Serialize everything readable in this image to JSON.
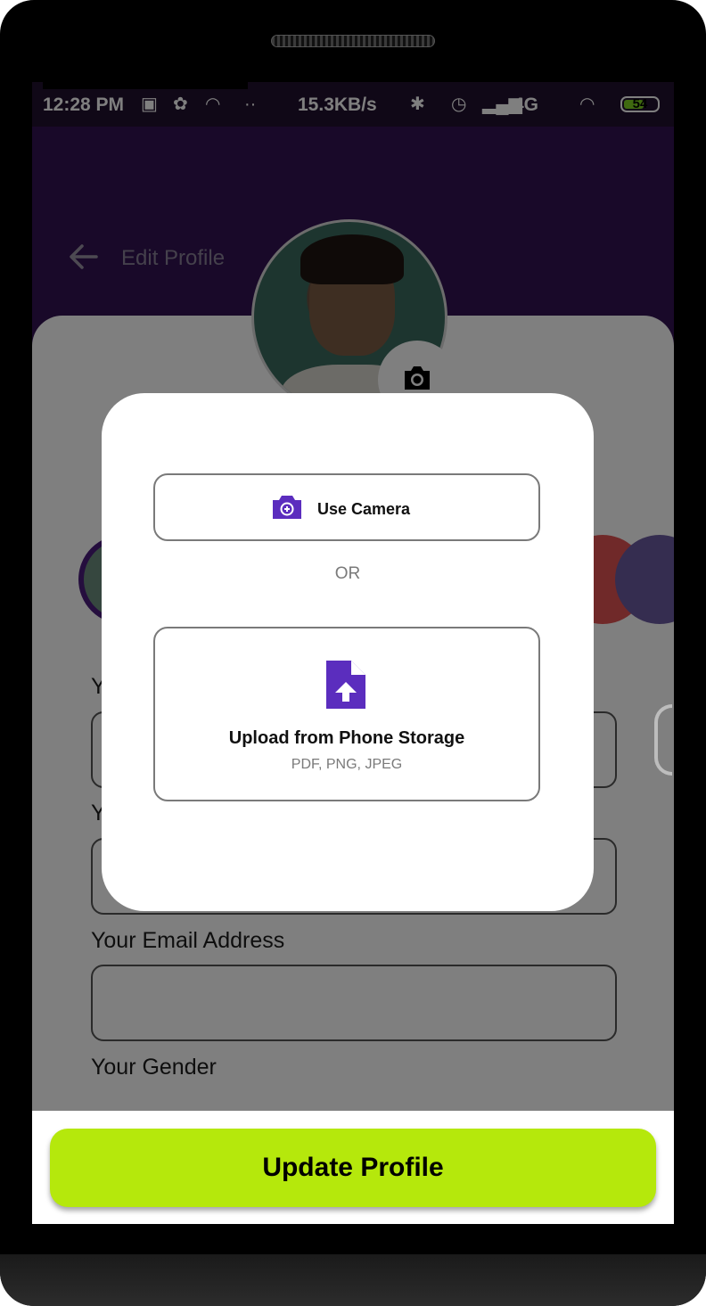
{
  "status_bar": {
    "time": "12:28 PM",
    "speed": "15.3KB/s",
    "network": "4G",
    "battery": "54"
  },
  "header": {
    "title": "Edit Profile"
  },
  "form": {
    "fields": [
      {
        "label": "Y",
        "value": ""
      },
      {
        "label": "Y",
        "value": ""
      },
      {
        "label": "Your Email Address",
        "value": ""
      }
    ],
    "gender_label": "Your Gender"
  },
  "dialog": {
    "camera_option": "Use Camera",
    "separator": "OR",
    "upload_title": "Upload from Phone Storage",
    "upload_formats": "PDF, PNG, JPEG"
  },
  "update_button": "Update Profile",
  "colors": {
    "header_purple": "#331353",
    "accent_purple": "#5b2dbe",
    "button_green": "#b5e80c"
  }
}
